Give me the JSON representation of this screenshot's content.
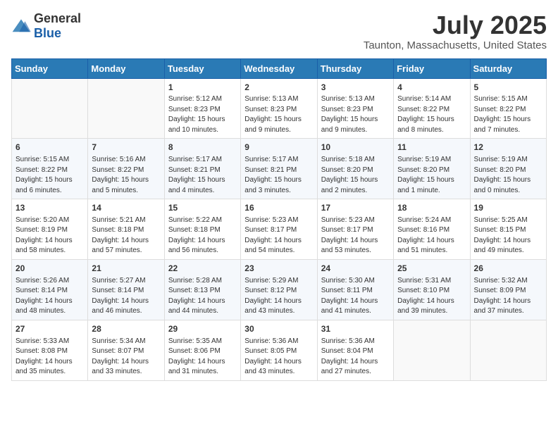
{
  "header": {
    "logo_general": "General",
    "logo_blue": "Blue",
    "month": "July 2025",
    "location": "Taunton, Massachusetts, United States"
  },
  "days_of_week": [
    "Sunday",
    "Monday",
    "Tuesday",
    "Wednesday",
    "Thursday",
    "Friday",
    "Saturday"
  ],
  "weeks": [
    [
      {
        "day": "",
        "info": ""
      },
      {
        "day": "",
        "info": ""
      },
      {
        "day": "1",
        "info": "Sunrise: 5:12 AM\nSunset: 8:23 PM\nDaylight: 15 hours and 10 minutes."
      },
      {
        "day": "2",
        "info": "Sunrise: 5:13 AM\nSunset: 8:23 PM\nDaylight: 15 hours and 9 minutes."
      },
      {
        "day": "3",
        "info": "Sunrise: 5:13 AM\nSunset: 8:23 PM\nDaylight: 15 hours and 9 minutes."
      },
      {
        "day": "4",
        "info": "Sunrise: 5:14 AM\nSunset: 8:22 PM\nDaylight: 15 hours and 8 minutes."
      },
      {
        "day": "5",
        "info": "Sunrise: 5:15 AM\nSunset: 8:22 PM\nDaylight: 15 hours and 7 minutes."
      }
    ],
    [
      {
        "day": "6",
        "info": "Sunrise: 5:15 AM\nSunset: 8:22 PM\nDaylight: 15 hours and 6 minutes."
      },
      {
        "day": "7",
        "info": "Sunrise: 5:16 AM\nSunset: 8:22 PM\nDaylight: 15 hours and 5 minutes."
      },
      {
        "day": "8",
        "info": "Sunrise: 5:17 AM\nSunset: 8:21 PM\nDaylight: 15 hours and 4 minutes."
      },
      {
        "day": "9",
        "info": "Sunrise: 5:17 AM\nSunset: 8:21 PM\nDaylight: 15 hours and 3 minutes."
      },
      {
        "day": "10",
        "info": "Sunrise: 5:18 AM\nSunset: 8:20 PM\nDaylight: 15 hours and 2 minutes."
      },
      {
        "day": "11",
        "info": "Sunrise: 5:19 AM\nSunset: 8:20 PM\nDaylight: 15 hours and 1 minute."
      },
      {
        "day": "12",
        "info": "Sunrise: 5:19 AM\nSunset: 8:20 PM\nDaylight: 15 hours and 0 minutes."
      }
    ],
    [
      {
        "day": "13",
        "info": "Sunrise: 5:20 AM\nSunset: 8:19 PM\nDaylight: 14 hours and 58 minutes."
      },
      {
        "day": "14",
        "info": "Sunrise: 5:21 AM\nSunset: 8:18 PM\nDaylight: 14 hours and 57 minutes."
      },
      {
        "day": "15",
        "info": "Sunrise: 5:22 AM\nSunset: 8:18 PM\nDaylight: 14 hours and 56 minutes."
      },
      {
        "day": "16",
        "info": "Sunrise: 5:23 AM\nSunset: 8:17 PM\nDaylight: 14 hours and 54 minutes."
      },
      {
        "day": "17",
        "info": "Sunrise: 5:23 AM\nSunset: 8:17 PM\nDaylight: 14 hours and 53 minutes."
      },
      {
        "day": "18",
        "info": "Sunrise: 5:24 AM\nSunset: 8:16 PM\nDaylight: 14 hours and 51 minutes."
      },
      {
        "day": "19",
        "info": "Sunrise: 5:25 AM\nSunset: 8:15 PM\nDaylight: 14 hours and 49 minutes."
      }
    ],
    [
      {
        "day": "20",
        "info": "Sunrise: 5:26 AM\nSunset: 8:14 PM\nDaylight: 14 hours and 48 minutes."
      },
      {
        "day": "21",
        "info": "Sunrise: 5:27 AM\nSunset: 8:14 PM\nDaylight: 14 hours and 46 minutes."
      },
      {
        "day": "22",
        "info": "Sunrise: 5:28 AM\nSunset: 8:13 PM\nDaylight: 14 hours and 44 minutes."
      },
      {
        "day": "23",
        "info": "Sunrise: 5:29 AM\nSunset: 8:12 PM\nDaylight: 14 hours and 43 minutes."
      },
      {
        "day": "24",
        "info": "Sunrise: 5:30 AM\nSunset: 8:11 PM\nDaylight: 14 hours and 41 minutes."
      },
      {
        "day": "25",
        "info": "Sunrise: 5:31 AM\nSunset: 8:10 PM\nDaylight: 14 hours and 39 minutes."
      },
      {
        "day": "26",
        "info": "Sunrise: 5:32 AM\nSunset: 8:09 PM\nDaylight: 14 hours and 37 minutes."
      }
    ],
    [
      {
        "day": "27",
        "info": "Sunrise: 5:33 AM\nSunset: 8:08 PM\nDaylight: 14 hours and 35 minutes."
      },
      {
        "day": "28",
        "info": "Sunrise: 5:34 AM\nSunset: 8:07 PM\nDaylight: 14 hours and 33 minutes."
      },
      {
        "day": "29",
        "info": "Sunrise: 5:35 AM\nSunset: 8:06 PM\nDaylight: 14 hours and 31 minutes."
      },
      {
        "day": "30",
        "info": "Sunrise: 5:36 AM\nSunset: 8:05 PM\nDaylight: 14 hours and 43 minutes."
      },
      {
        "day": "31",
        "info": "Sunrise: 5:36 AM\nSunset: 8:04 PM\nDaylight: 14 hours and 27 minutes."
      },
      {
        "day": "",
        "info": ""
      },
      {
        "day": "",
        "info": ""
      }
    ]
  ]
}
